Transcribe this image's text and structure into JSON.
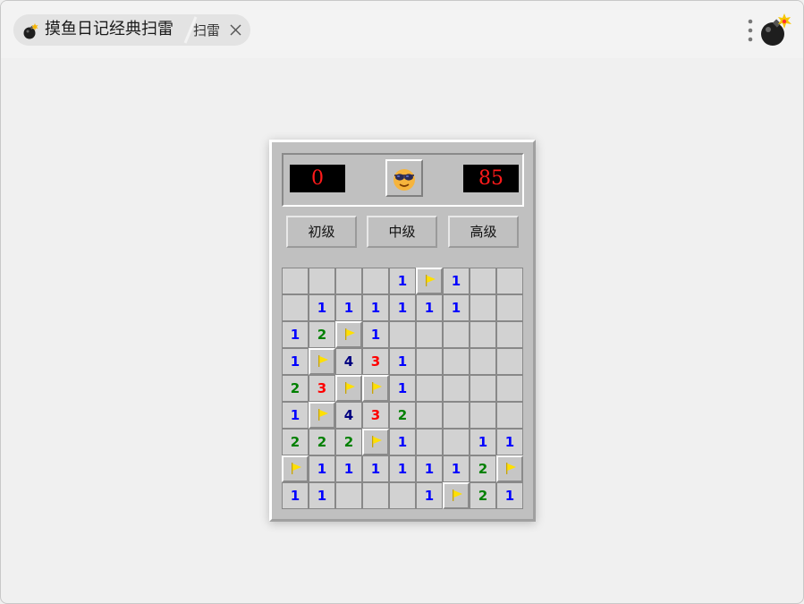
{
  "tabs": {
    "main_title": "摸鱼日记经典扫雷",
    "sub_title": "扫雷"
  },
  "game": {
    "mine_counter": "0",
    "timer": "85",
    "levels": [
      {
        "id": "beginner",
        "label": "初级"
      },
      {
        "id": "intermediate",
        "label": "中级"
      },
      {
        "id": "expert",
        "label": "高级"
      }
    ],
    "number_colors": {
      "1": "#0000ff",
      "2": "#008000",
      "3": "#ff0000",
      "4": "#000080"
    },
    "board": [
      [
        "",
        "",
        "",
        "",
        "1",
        "F",
        "1",
        "",
        ""
      ],
      [
        "",
        "1",
        "1",
        "1",
        "1",
        "1",
        "1",
        "",
        ""
      ],
      [
        "1",
        "2",
        "F",
        "1",
        "",
        "",
        "",
        "",
        ""
      ],
      [
        "1",
        "F",
        "4",
        "3",
        "1",
        "",
        "",
        "",
        ""
      ],
      [
        "2",
        "3",
        "F",
        "F",
        "1",
        "",
        "",
        "",
        ""
      ],
      [
        "1",
        "F",
        "4",
        "3",
        "2",
        "",
        "",
        "",
        ""
      ],
      [
        "2",
        "2",
        "2",
        "F",
        "1",
        "",
        "",
        "1",
        "1"
      ],
      [
        "F",
        "1",
        "1",
        "1",
        "1",
        "1",
        "1",
        "2",
        "F"
      ],
      [
        "1",
        "1",
        "",
        "",
        "",
        "1",
        "F",
        "2",
        "1"
      ]
    ]
  }
}
